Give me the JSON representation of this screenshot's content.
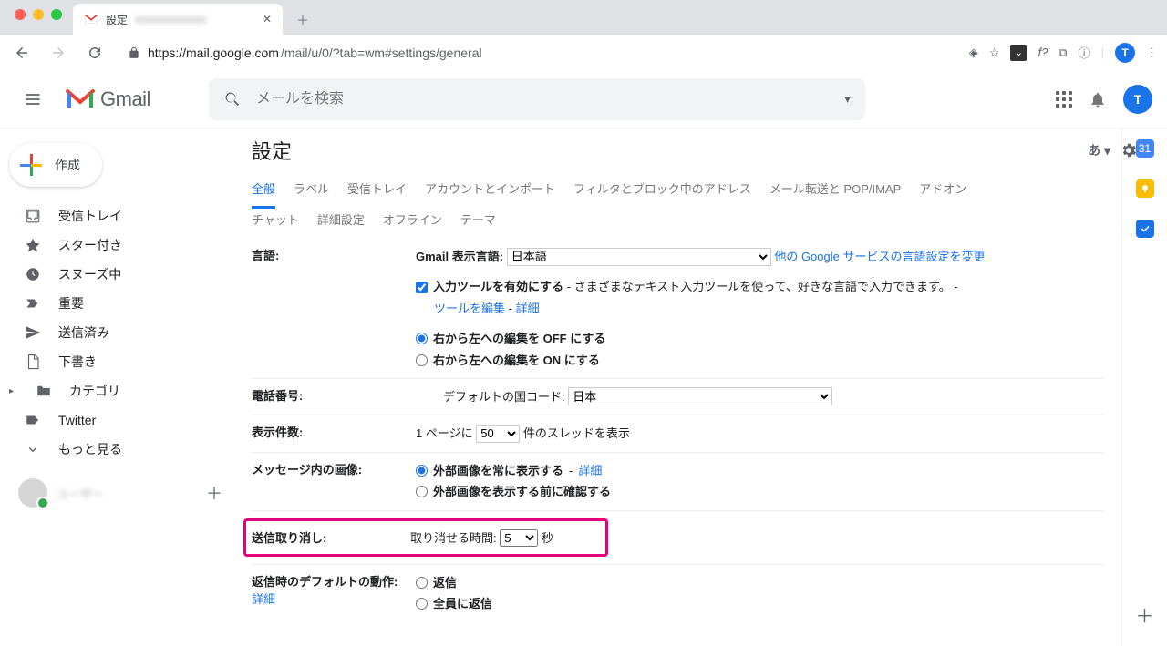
{
  "browser": {
    "tab_title": "設定",
    "url_host": "https://mail.google.com",
    "url_path": "/mail/u/0/?tab=wm#settings/general",
    "avatar_letter": "T",
    "ext_fp": "f?"
  },
  "header": {
    "product_name": "Gmail",
    "search_placeholder": "メールを検索",
    "avatar_letter": "T"
  },
  "sidebar": {
    "compose": "作成",
    "items": [
      {
        "label": "受信トレイ",
        "icon": "inbox"
      },
      {
        "label": "スター付き",
        "icon": "star"
      },
      {
        "label": "スヌーズ中",
        "icon": "clock"
      },
      {
        "label": "重要",
        "icon": "important"
      },
      {
        "label": "送信済み",
        "icon": "send"
      },
      {
        "label": "下書き",
        "icon": "draft"
      },
      {
        "label": "カテゴリ",
        "icon": "folder",
        "caret": true
      },
      {
        "label": "Twitter",
        "icon": "label"
      },
      {
        "label": "もっと見る",
        "icon": "more"
      }
    ],
    "hangouts_name": "ユーザー"
  },
  "content": {
    "title": "設定",
    "lang_indicator": "あ",
    "tabs_primary": [
      "全般",
      "ラベル",
      "受信トレイ",
      "アカウントとインポート",
      "フィルタとブロック中のアドレス",
      "メール転送と POP/IMAP",
      "アドオン"
    ],
    "tabs_secondary": [
      "チャット",
      "詳細設定",
      "オフライン",
      "テーマ"
    ],
    "active_tab": "全般",
    "rows": {
      "language": {
        "label": "言語:",
        "display_lang_label": "Gmail 表示言語:",
        "display_lang_value": "日本語",
        "other_services_link": "他の Google サービスの言語設定を変更",
        "input_tools_bold": "入力ツールを有効にする",
        "input_tools_desc": " - さまざまなテキスト入力ツールを使って、好きな言語で入力できます。 - ",
        "edit_tools_link": "ツールを編集",
        "dash": " - ",
        "detail_link": "詳細",
        "rtl_off": "右から左への編集を OFF にする",
        "rtl_on": "右から左への編集を ON にする"
      },
      "phone": {
        "label": "電話番号:",
        "prefix": "デフォルトの国コード:",
        "value": "日本"
      },
      "pagesize": {
        "label": "表示件数:",
        "prefix": "1 ページに",
        "value": "50",
        "suffix": "件のスレッドを表示"
      },
      "images": {
        "label": "メッセージ内の画像:",
        "opt1": "外部画像を常に表示する",
        "detail": "詳細",
        "opt2": "外部画像を表示する前に確認する"
      },
      "undo": {
        "label": "送信取り消し:",
        "prefix": "取り消せる時間:",
        "value": "5",
        "suffix": "秒"
      },
      "reply": {
        "label": "返信時のデフォルトの動作:",
        "detail": "詳細",
        "opt1": "返信",
        "opt2": "全員に返信"
      }
    }
  },
  "rail": {
    "cal_day": "31"
  }
}
